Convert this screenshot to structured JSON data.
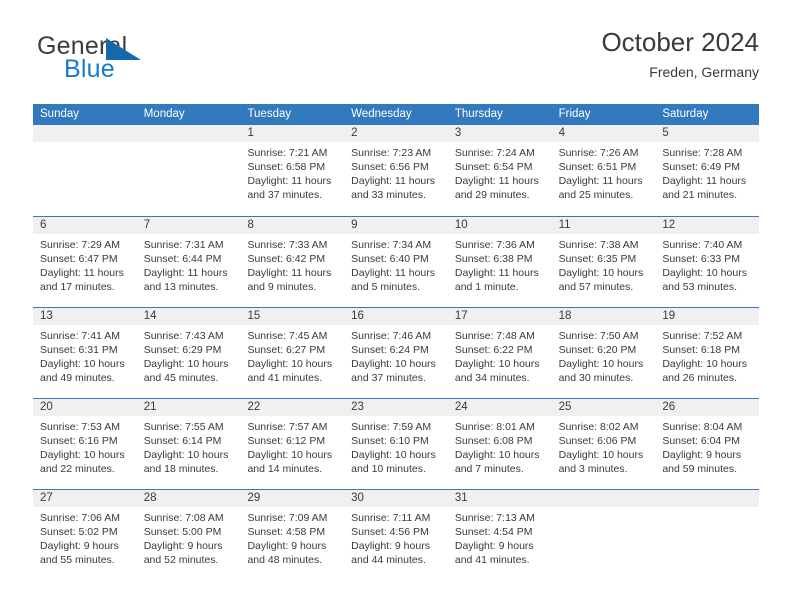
{
  "brand": {
    "word_one": "General",
    "word_two": "Blue",
    "triangle_icon": "blue-triangle-logo-mark",
    "accent_color": "#1a79c8"
  },
  "header": {
    "title": "October 2024",
    "subtitle": "Freden, Germany"
  },
  "theme": {
    "header_blue": "#3279bd",
    "day_band_gray": "#f0f0f0",
    "text_color": "#3a3a3a"
  },
  "weekdays": [
    "Sunday",
    "Monday",
    "Tuesday",
    "Wednesday",
    "Thursday",
    "Friday",
    "Saturday"
  ],
  "labels": {
    "sunrise_prefix": "Sunrise:",
    "sunset_prefix": "Sunset:",
    "daylight_prefix": "Daylight:"
  },
  "weeks": [
    [
      {
        "day": "",
        "empty": true
      },
      {
        "day": "",
        "empty": true
      },
      {
        "day": "1",
        "sunrise": "Sunrise: 7:21 AM",
        "sunset": "Sunset: 6:58 PM",
        "daylight": "Daylight: 11 hours and 37 minutes."
      },
      {
        "day": "2",
        "sunrise": "Sunrise: 7:23 AM",
        "sunset": "Sunset: 6:56 PM",
        "daylight": "Daylight: 11 hours and 33 minutes."
      },
      {
        "day": "3",
        "sunrise": "Sunrise: 7:24 AM",
        "sunset": "Sunset: 6:54 PM",
        "daylight": "Daylight: 11 hours and 29 minutes."
      },
      {
        "day": "4",
        "sunrise": "Sunrise: 7:26 AM",
        "sunset": "Sunset: 6:51 PM",
        "daylight": "Daylight: 11 hours and 25 minutes."
      },
      {
        "day": "5",
        "sunrise": "Sunrise: 7:28 AM",
        "sunset": "Sunset: 6:49 PM",
        "daylight": "Daylight: 11 hours and 21 minutes."
      }
    ],
    [
      {
        "day": "6",
        "sunrise": "Sunrise: 7:29 AM",
        "sunset": "Sunset: 6:47 PM",
        "daylight": "Daylight: 11 hours and 17 minutes."
      },
      {
        "day": "7",
        "sunrise": "Sunrise: 7:31 AM",
        "sunset": "Sunset: 6:44 PM",
        "daylight": "Daylight: 11 hours and 13 minutes."
      },
      {
        "day": "8",
        "sunrise": "Sunrise: 7:33 AM",
        "sunset": "Sunset: 6:42 PM",
        "daylight": "Daylight: 11 hours and 9 minutes."
      },
      {
        "day": "9",
        "sunrise": "Sunrise: 7:34 AM",
        "sunset": "Sunset: 6:40 PM",
        "daylight": "Daylight: 11 hours and 5 minutes."
      },
      {
        "day": "10",
        "sunrise": "Sunrise: 7:36 AM",
        "sunset": "Sunset: 6:38 PM",
        "daylight": "Daylight: 11 hours and 1 minute."
      },
      {
        "day": "11",
        "sunrise": "Sunrise: 7:38 AM",
        "sunset": "Sunset: 6:35 PM",
        "daylight": "Daylight: 10 hours and 57 minutes."
      },
      {
        "day": "12",
        "sunrise": "Sunrise: 7:40 AM",
        "sunset": "Sunset: 6:33 PM",
        "daylight": "Daylight: 10 hours and 53 minutes."
      }
    ],
    [
      {
        "day": "13",
        "sunrise": "Sunrise: 7:41 AM",
        "sunset": "Sunset: 6:31 PM",
        "daylight": "Daylight: 10 hours and 49 minutes."
      },
      {
        "day": "14",
        "sunrise": "Sunrise: 7:43 AM",
        "sunset": "Sunset: 6:29 PM",
        "daylight": "Daylight: 10 hours and 45 minutes."
      },
      {
        "day": "15",
        "sunrise": "Sunrise: 7:45 AM",
        "sunset": "Sunset: 6:27 PM",
        "daylight": "Daylight: 10 hours and 41 minutes."
      },
      {
        "day": "16",
        "sunrise": "Sunrise: 7:46 AM",
        "sunset": "Sunset: 6:24 PM",
        "daylight": "Daylight: 10 hours and 37 minutes."
      },
      {
        "day": "17",
        "sunrise": "Sunrise: 7:48 AM",
        "sunset": "Sunset: 6:22 PM",
        "daylight": "Daylight: 10 hours and 34 minutes."
      },
      {
        "day": "18",
        "sunrise": "Sunrise: 7:50 AM",
        "sunset": "Sunset: 6:20 PM",
        "daylight": "Daylight: 10 hours and 30 minutes."
      },
      {
        "day": "19",
        "sunrise": "Sunrise: 7:52 AM",
        "sunset": "Sunset: 6:18 PM",
        "daylight": "Daylight: 10 hours and 26 minutes."
      }
    ],
    [
      {
        "day": "20",
        "sunrise": "Sunrise: 7:53 AM",
        "sunset": "Sunset: 6:16 PM",
        "daylight": "Daylight: 10 hours and 22 minutes."
      },
      {
        "day": "21",
        "sunrise": "Sunrise: 7:55 AM",
        "sunset": "Sunset: 6:14 PM",
        "daylight": "Daylight: 10 hours and 18 minutes."
      },
      {
        "day": "22",
        "sunrise": "Sunrise: 7:57 AM",
        "sunset": "Sunset: 6:12 PM",
        "daylight": "Daylight: 10 hours and 14 minutes."
      },
      {
        "day": "23",
        "sunrise": "Sunrise: 7:59 AM",
        "sunset": "Sunset: 6:10 PM",
        "daylight": "Daylight: 10 hours and 10 minutes."
      },
      {
        "day": "24",
        "sunrise": "Sunrise: 8:01 AM",
        "sunset": "Sunset: 6:08 PM",
        "daylight": "Daylight: 10 hours and 7 minutes."
      },
      {
        "day": "25",
        "sunrise": "Sunrise: 8:02 AM",
        "sunset": "Sunset: 6:06 PM",
        "daylight": "Daylight: 10 hours and 3 minutes."
      },
      {
        "day": "26",
        "sunrise": "Sunrise: 8:04 AM",
        "sunset": "Sunset: 6:04 PM",
        "daylight": "Daylight: 9 hours and 59 minutes."
      }
    ],
    [
      {
        "day": "27",
        "sunrise": "Sunrise: 7:06 AM",
        "sunset": "Sunset: 5:02 PM",
        "daylight": "Daylight: 9 hours and 55 minutes."
      },
      {
        "day": "28",
        "sunrise": "Sunrise: 7:08 AM",
        "sunset": "Sunset: 5:00 PM",
        "daylight": "Daylight: 9 hours and 52 minutes."
      },
      {
        "day": "29",
        "sunrise": "Sunrise: 7:09 AM",
        "sunset": "Sunset: 4:58 PM",
        "daylight": "Daylight: 9 hours and 48 minutes."
      },
      {
        "day": "30",
        "sunrise": "Sunrise: 7:11 AM",
        "sunset": "Sunset: 4:56 PM",
        "daylight": "Daylight: 9 hours and 44 minutes."
      },
      {
        "day": "31",
        "sunrise": "Sunrise: 7:13 AM",
        "sunset": "Sunset: 4:54 PM",
        "daylight": "Daylight: 9 hours and 41 minutes."
      },
      {
        "day": "",
        "empty": true
      },
      {
        "day": "",
        "empty": true
      }
    ]
  ]
}
